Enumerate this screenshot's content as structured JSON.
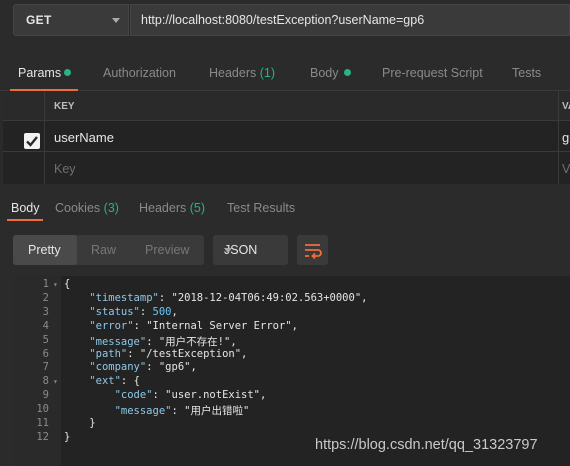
{
  "request": {
    "method": "GET",
    "url": "http://localhost:8080/testException?userName=gp6"
  },
  "request_tabs": [
    {
      "label": "Params",
      "active": true,
      "dot": true
    },
    {
      "label": "Authorization"
    },
    {
      "label": "Headers",
      "count": "(1)"
    },
    {
      "label": "Body",
      "dot": true
    },
    {
      "label": "Pre-request Script"
    },
    {
      "label": "Tests"
    }
  ],
  "params": {
    "header_key": "KEY",
    "header_value": "VA",
    "rows": [
      {
        "checked": true,
        "key": "userName",
        "value": "g"
      }
    ],
    "placeholder_key": "Key",
    "placeholder_value": "V"
  },
  "response_tabs": [
    {
      "label": "Body",
      "active": true
    },
    {
      "label": "Cookies",
      "count": "(3)"
    },
    {
      "label": "Headers",
      "count": "(5)"
    },
    {
      "label": "Test Results"
    }
  ],
  "toolbar": {
    "view_options": [
      "Pretty",
      "Raw",
      "Preview"
    ],
    "selected_view": "Pretty",
    "format": "JSON"
  },
  "code_lines": [
    {
      "n": "1",
      "fold": "▾",
      "t": "{"
    },
    {
      "n": "2",
      "k": "\"timestamp\"",
      "v": "\"2018-12-04T06:49:02.563+0000\"",
      "indent": 1
    },
    {
      "n": "3",
      "k": "\"status\"",
      "v": "500",
      "num": true,
      "indent": 1
    },
    {
      "n": "4",
      "k": "\"error\"",
      "v": "\"Internal Server Error\"",
      "indent": 1
    },
    {
      "n": "5",
      "k": "\"message\"",
      "v": "\"用户不存在!\"",
      "indent": 1
    },
    {
      "n": "6",
      "k": "\"path\"",
      "v": "\"/testException\"",
      "indent": 1
    },
    {
      "n": "7",
      "k": "\"company\"",
      "v": "\"gp6\"",
      "indent": 1
    },
    {
      "n": "8",
      "fold": "▾",
      "k": "\"ext\"",
      "v": "{",
      "raw": true,
      "indent": 1
    },
    {
      "n": "9",
      "k": "\"code\"",
      "v": "\"user.notExist\"",
      "indent": 2
    },
    {
      "n": "10",
      "k": "\"message\"",
      "v": "\"用户出错啦\"",
      "indent": 2,
      "last": true
    },
    {
      "n": "11",
      "t": "}",
      "indent": 1
    },
    {
      "n": "12",
      "t": "}"
    }
  ],
  "watermark": "https://blog.csdn.net/qq_31323797"
}
